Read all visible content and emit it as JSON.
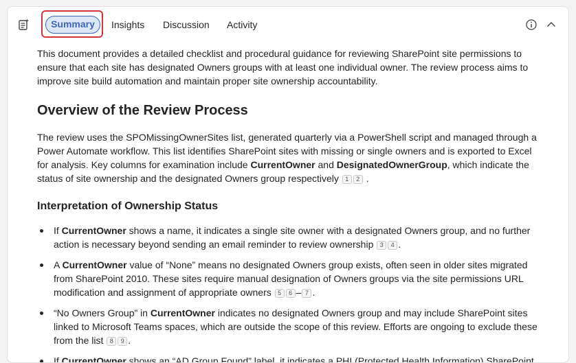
{
  "tabs": [
    {
      "label": "Summary",
      "selected": true
    },
    {
      "label": "Insights"
    },
    {
      "label": "Discussion"
    },
    {
      "label": "Activity"
    }
  ],
  "icons": {
    "header": "copilot-summary-icon",
    "info": "info-icon",
    "collapse": "chevron-up-icon"
  },
  "colors": {
    "accent": "#3b67b5",
    "highlight_border": "#d13438",
    "tab_bg": "#dde7f8"
  },
  "intro": "This document provides a detailed checklist and procedural guidance for reviewing SharePoint site permissions to ensure that each site has designated Owners groups with at least one individual owner. The review process aims to improve site build automation and maintain proper site ownership accountability.",
  "overview": {
    "heading": "Overview of the Review Process",
    "p1": "The review uses the SPOMissingOwnerSites list, generated quarterly via a PowerShell script and managed through a Power Automate workflow. This list identifies SharePoint sites with missing or single owners and is exported to Excel for analysis. Key columns for examination include ",
    "b1": "CurrentOwner",
    "p2": " and ",
    "b2": "DesignatedOwnerGroup",
    "p3": ", which indicate the status of site ownership and the designated Owners group respectively",
    "c1": "1",
    "c2": "2",
    "end": "."
  },
  "interpretation": {
    "heading": "Interpretation of Ownership Status",
    "items": [
      {
        "pre": "If ",
        "bold": "CurrentOwner",
        "post": " shows a name, it indicates a single site owner with a designated Owners group, and no further action is necessary beyond sending an email reminder to review ownership",
        "c1": "3",
        "c2": "4",
        "end": "."
      },
      {
        "pre": "A ",
        "bold": "CurrentOwner",
        "post": " value of “None” means no designated Owners group exists, often seen in older sites migrated from SharePoint 2010. These sites require manual designation of Owners groups via the site permissions URL modification and assignment of appropriate owners",
        "c1": "5",
        "c2": "6",
        "dash": "–",
        "c3": "7",
        "end": "."
      },
      {
        "pre": "“No Owners Group” in ",
        "bold": "CurrentOwner",
        "post": " indicates no designated Owners group and may include SharePoint sites linked to Microsoft Teams spaces, which are outside the scope of this review. Efforts are ongoing to exclude these from the list",
        "c1": "8",
        "c2": "9",
        "end": "."
      },
      {
        "pre": "If ",
        "bold": "CurrentOwner",
        "post": " shows an “AD Group Found” label, it indicates a PHI (Protected Health Information) SharePoint"
      }
    ]
  }
}
